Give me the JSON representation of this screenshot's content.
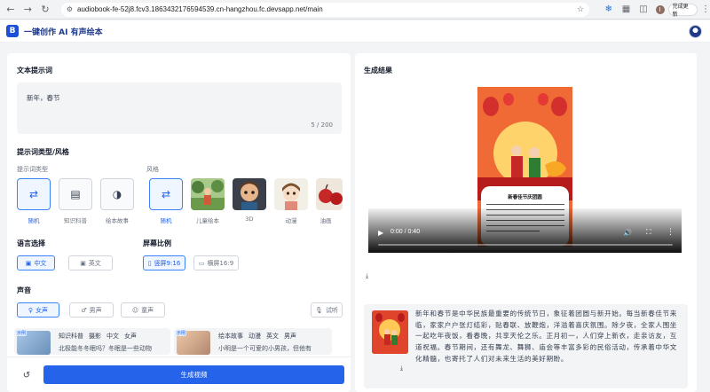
{
  "browser": {
    "url": "audiobook-fe-52j8.fcv3.1863432176594539.cn-hangzhou.fc.devsapp.net/main",
    "profile_initial": "I",
    "update_label": "完成更新"
  },
  "header": {
    "logo_text": "B",
    "title": "一键创作 AI 有声绘本"
  },
  "prompt_section": {
    "title": "文本提示词",
    "value": "新年，春节",
    "count": "5 / 200"
  },
  "type_section": {
    "title": "提示词类型/风格",
    "type_label": "提示词类型",
    "style_label": "风格",
    "types": [
      {
        "label": "随机",
        "icon": "shuffle-icon",
        "active": true
      },
      {
        "label": "知识科普",
        "icon": "book-icon",
        "active": false
      },
      {
        "label": "绘本故事",
        "icon": "palette-icon",
        "active": false
      }
    ],
    "styles": [
      {
        "label": "随机",
        "icon": "shuffle-icon",
        "active": true
      },
      {
        "label": "儿童绘本"
      },
      {
        "label": "3D"
      },
      {
        "label": "动漫"
      },
      {
        "label": "油画"
      }
    ]
  },
  "language_section": {
    "title": "语言选择",
    "options": [
      {
        "label": "中文",
        "active": true
      },
      {
        "label": "英文",
        "active": false
      }
    ]
  },
  "ratio_section": {
    "title": "屏幕比例",
    "options": [
      {
        "label": "竖屏9:16",
        "active": true
      },
      {
        "label": "横屏16:9",
        "active": false
      }
    ]
  },
  "voice_section": {
    "title": "声音",
    "options": [
      {
        "label": "女声",
        "active": true
      },
      {
        "label": "男声",
        "active": false
      },
      {
        "label": "童声",
        "active": false
      }
    ],
    "preview_label": "试听",
    "cards": [
      {
        "badge": "示例",
        "tags": [
          "知识科普",
          "摄影",
          "中文",
          "女声"
        ],
        "desc": "北极能冬冬眠吗？冬眠是一些动物"
      },
      {
        "badge": "示例",
        "tags": [
          "绘本故事",
          "动漫",
          "英文",
          "男声"
        ],
        "desc": "小明是一个可爱的小男孩，但他有"
      }
    ]
  },
  "actions": {
    "generate_label": "生成视频"
  },
  "result_section": {
    "title": "生成结果",
    "poster_title": "新春佳节庆团圆",
    "video_time": "0:00 / 0:40",
    "story": "新年和春节是中华民族最重要的传统节日，象征着团圆与新开始。每当新春佳节来临，家家户户张灯结彩，贴春联、放鞭炮，洋溢着喜庆氛围。除夕夜，全家人围坐一起吃年夜饭，看春晚，共享天伦之乐。正月初一，人们穿上新衣，走亲访友，互道祝福。春节期间，还有舞龙、舞狮、庙会等丰富多彩的民俗活动，传承着中华文化精髓，也寄托了人们对未来生活的美好期盼。"
  },
  "colors": {
    "primary": "#2563eb",
    "active_bg": "#eff6ff",
    "panel_bg": "#f3f4f6"
  }
}
